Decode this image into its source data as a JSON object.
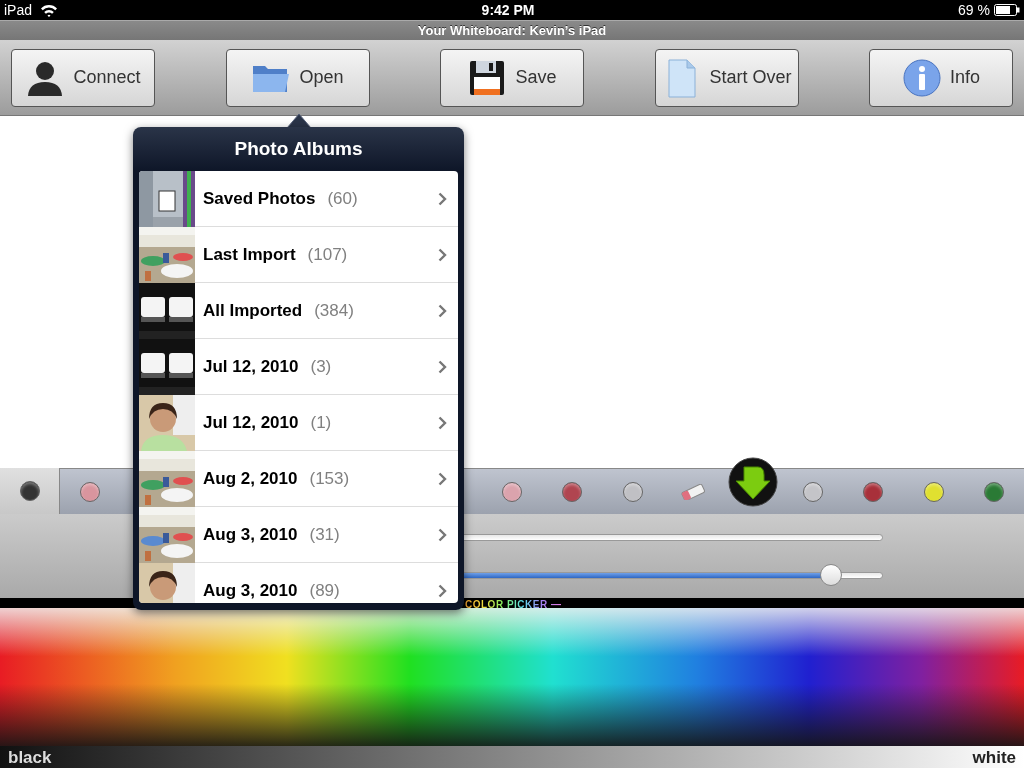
{
  "status_bar": {
    "carrier": "iPad",
    "time": "9:42 PM",
    "battery": "69 %"
  },
  "title": "Your Whiteboard: Kevin’s iPad",
  "toolbar": [
    {
      "label": "Connect",
      "kind": "person"
    },
    {
      "label": "Open",
      "kind": "folder"
    },
    {
      "label": "Save",
      "kind": "floppy"
    },
    {
      "label": "Start Over",
      "kind": "document"
    },
    {
      "label": "Info",
      "kind": "info"
    }
  ],
  "palette_left": [
    {
      "kind": "dot",
      "color": "#333333",
      "selected": true
    },
    {
      "kind": "dot",
      "color": "#d9959e",
      "selected": false
    }
  ],
  "palette_right": [
    {
      "kind": "dot",
      "color": "#dba3ad",
      "selected": false
    },
    {
      "kind": "dot",
      "color": "#b04550",
      "selected": false
    },
    {
      "kind": "dot",
      "color": "#c0c0c4",
      "selected": false
    },
    {
      "kind": "eraser"
    },
    {
      "kind": "arrow"
    },
    {
      "kind": "dot",
      "color": "#c4c4c8",
      "selected": false
    },
    {
      "kind": "dot",
      "color": "#a8303a",
      "selected": false
    },
    {
      "kind": "dot",
      "color": "#e0e030",
      "selected": false
    },
    {
      "kind": "dot",
      "color": "#2a7a35",
      "selected": false
    }
  ],
  "sliders": [
    {
      "kind": "track"
    },
    {
      "kind": "slider",
      "level": 0.93
    }
  ],
  "color_picker": {
    "label": "COLOR PICKER —",
    "left_label": "black",
    "right_label": "white"
  },
  "popover": {
    "title": "Photo Albums",
    "albums": [
      {
        "name": "Saved Photos",
        "count": "(60)"
      },
      {
        "name": "Last Import",
        "count": "(107)"
      },
      {
        "name": "All Imported",
        "count": "(384)"
      },
      {
        "name": "Jul 12, 2010",
        "count": "(3)"
      },
      {
        "name": "Jul 12, 2010",
        "count": "(1)"
      },
      {
        "name": "Aug 2, 2010",
        "count": "(153)"
      },
      {
        "name": "Aug 3, 2010",
        "count": "(31)"
      },
      {
        "name": "Aug 3, 2010",
        "count": "(89)"
      }
    ]
  }
}
